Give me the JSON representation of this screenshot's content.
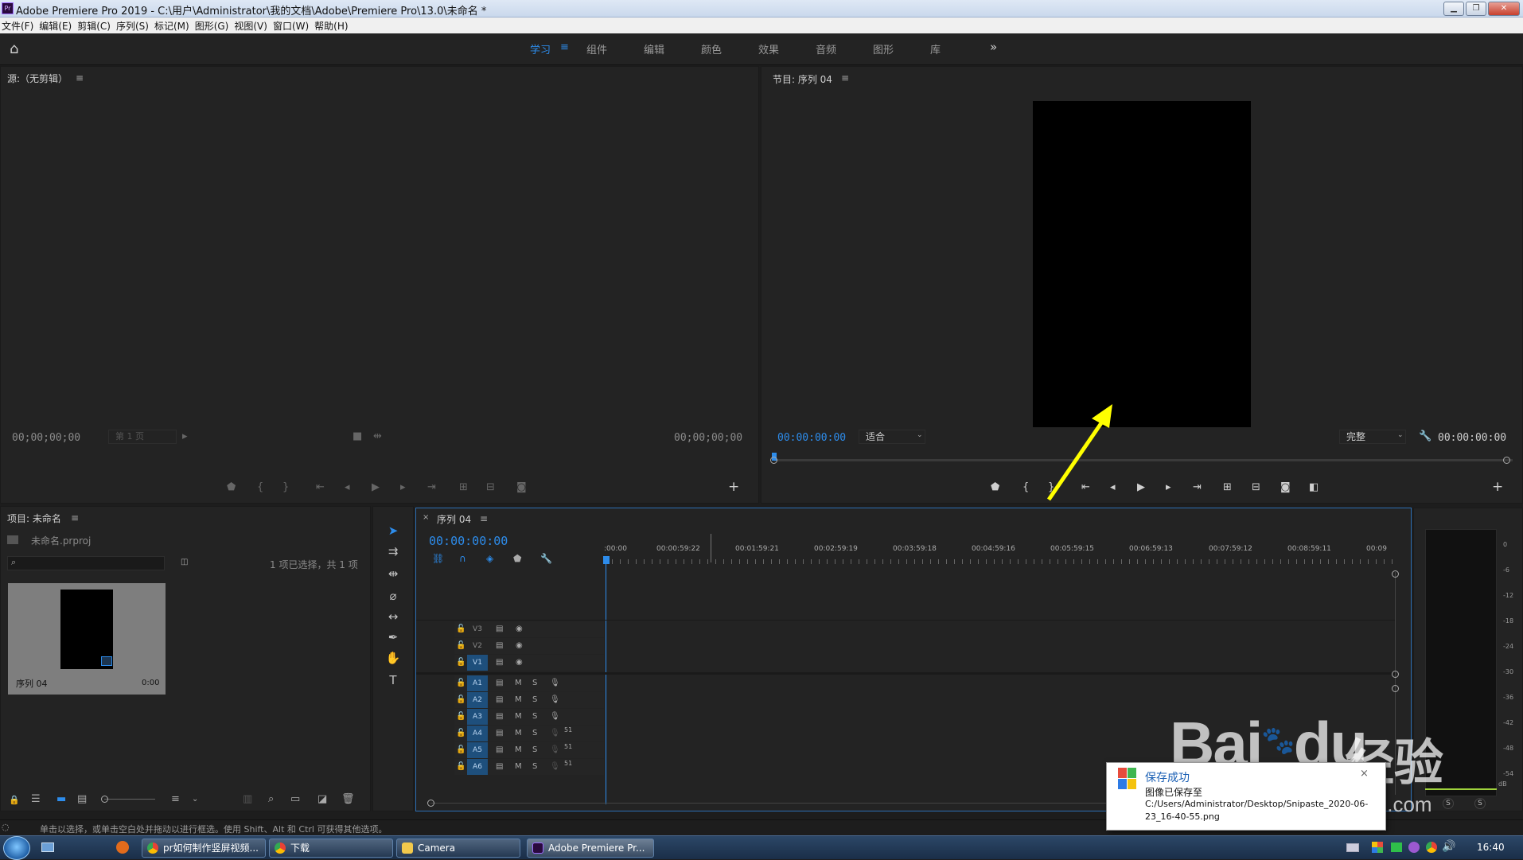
{
  "window": {
    "title": "Adobe Premiere Pro 2019 - C:\\用户\\Administrator\\我的文档\\Adobe\\Premiere Pro\\13.0\\未命名 *",
    "app_icon": "Pr"
  },
  "menu": [
    "文件(F)",
    "编辑(E)",
    "剪辑(C)",
    "序列(S)",
    "标记(M)",
    "图形(G)",
    "视图(V)",
    "窗口(W)",
    "帮助(H)"
  ],
  "workspaces": {
    "items": [
      "学习",
      "组件",
      "编辑",
      "颜色",
      "效果",
      "音频",
      "图形",
      "库"
    ],
    "active": "学习",
    "more": "»"
  },
  "source": {
    "title": "源:（无剪辑）",
    "tc_left": "00;00;00;00",
    "page": "第 1 页",
    "tc_right": "00;00;00;00"
  },
  "program": {
    "title": "节目: 序列 04",
    "tc_left": "00:00:00:00",
    "fit": "适合",
    "quality": "完整",
    "tc_right": "00:00:00:00"
  },
  "project": {
    "title": "项目: 未命名",
    "file": "未命名.prproj",
    "search_placeholder": "",
    "selection": "1 项已选择，共 1 项",
    "item_name": "序列 04",
    "item_duration": "0:00"
  },
  "timeline": {
    "tab": "序列 04",
    "timecode": "00:00:00:00",
    "ruler": [
      ":00:00",
      "00:00:59:22",
      "00:01:59:21",
      "00:02:59:19",
      "00:03:59:18",
      "00:04:59:16",
      "00:05:59:15",
      "00:06:59:13",
      "00:07:59:12",
      "00:08:59:11",
      "00:09"
    ],
    "video_tracks": [
      "V3",
      "V2",
      "V1"
    ],
    "audio_tracks": [
      "A1",
      "A2",
      "A3",
      "A4",
      "A5",
      "A6"
    ],
    "m": "M",
    "s": "S",
    "voice_level": "51"
  },
  "meter": {
    "ticks": [
      "0",
      "-6",
      "-12",
      "-18",
      "-24",
      "-30",
      "-36",
      "-42",
      "-48",
      "-54",
      "dB"
    ],
    "solo_l": "S",
    "solo_r": "S"
  },
  "status_text": "单击以选择，或单击空白处并拖动以进行框选。使用 Shift、Alt 和 Ctrl 可获得其他选项。",
  "notification": {
    "title": "保存成功",
    "line1": "图像已保存至",
    "line2": "C:/Users/Administrator/Desktop/Snipaste_2020-06-",
    "line3": "23_16-40-55.png"
  },
  "taskbar": {
    "buttons": [
      "pr如何制作竖屏视频...",
      "下载",
      "Camera",
      "Adobe Premiere Pr..."
    ],
    "clock": "16:40"
  },
  "watermark": {
    "brand": "Bai",
    "brand2": "du",
    "cn": "经验",
    "url": "jingyan.baidu.com"
  },
  "colors": {
    "accent": "#2d8ceb",
    "arrow": "#ffff00",
    "track_on": "#1e4f7c"
  }
}
